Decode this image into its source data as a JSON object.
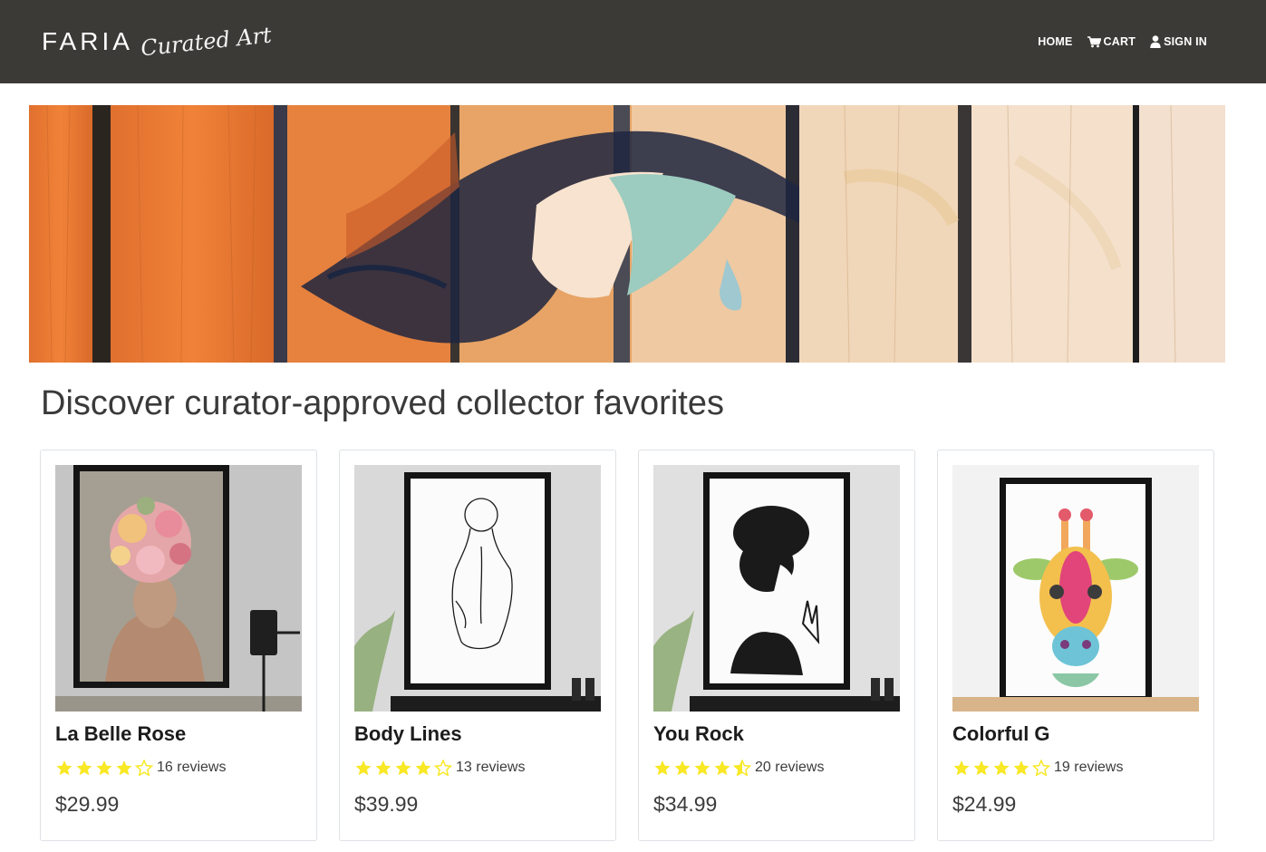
{
  "brand": {
    "name": "FARIA",
    "script": "Curated Art"
  },
  "nav": {
    "home": "HOME",
    "cart": "CART",
    "sign_in": "SIGN IN"
  },
  "section_title": "Discover curator-approved collector favorites",
  "colors": {
    "navbar": "#3b3a36",
    "star": "#f8e825",
    "text": "#3c3c3c"
  },
  "products": [
    {
      "name": "La Belle Rose",
      "rating": 4,
      "reviews_text": "16 reviews",
      "price": "$29.99",
      "image_icon": "floral-portrait-artwork"
    },
    {
      "name": "Body Lines",
      "rating": 4,
      "reviews_text": "13 reviews",
      "price": "$39.99",
      "image_icon": "line-art-figure-artwork"
    },
    {
      "name": "You Rock",
      "rating": 4.5,
      "reviews_text": "20 reviews",
      "price": "$34.99",
      "image_icon": "rock-woman-artwork"
    },
    {
      "name": "Colorful G",
      "rating": 4,
      "reviews_text": "19 reviews",
      "price": "$24.99",
      "image_icon": "colorful-giraffe-artwork"
    }
  ]
}
